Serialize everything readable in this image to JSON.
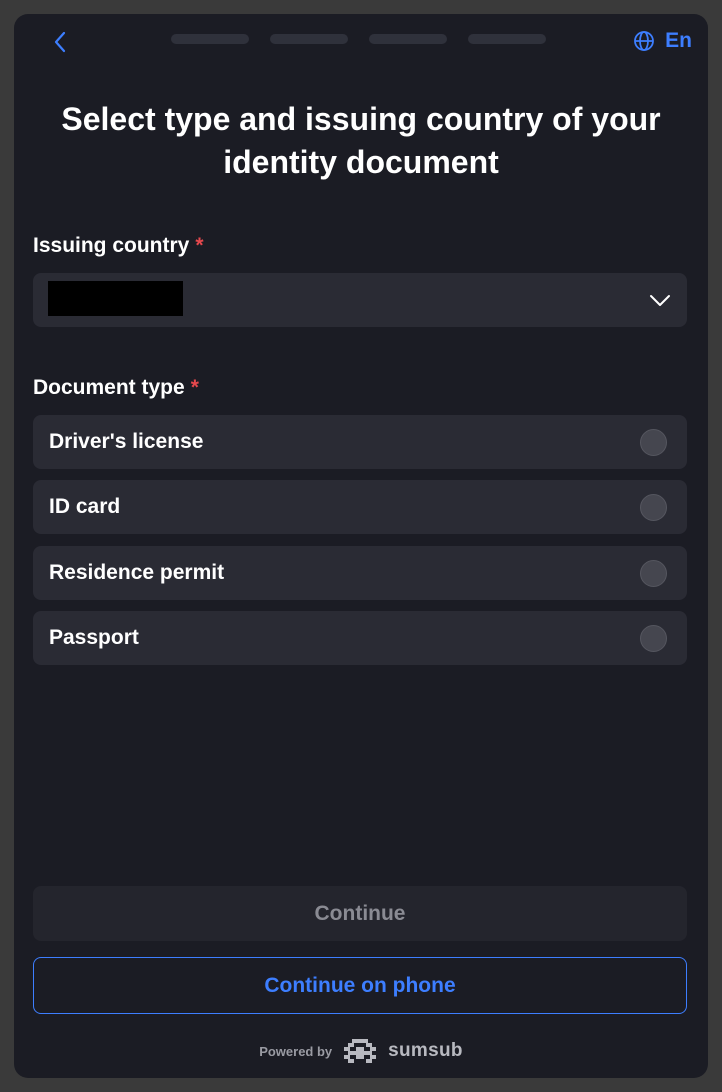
{
  "header": {
    "back_icon": "chevron-left-icon",
    "progress_steps": 4,
    "language_icon": "globe-icon",
    "language_label": "En"
  },
  "title": "Select type and issuing country of your identity document",
  "issuing_country": {
    "label": "Issuing country",
    "required_mark": "*",
    "value_redacted": true,
    "chevron_icon": "chevron-down-icon"
  },
  "document_type": {
    "label": "Document type",
    "required_mark": "*",
    "options": [
      {
        "label": "Driver's license",
        "selected": false
      },
      {
        "label": "ID card",
        "selected": false
      },
      {
        "label": "Residence permit",
        "selected": false
      },
      {
        "label": "Passport",
        "selected": false
      }
    ]
  },
  "actions": {
    "continue_label": "Continue",
    "continue_on_phone_label": "Continue on phone"
  },
  "footer": {
    "powered_by": "Powered by",
    "brand": "sumsub",
    "brand_icon": "sumsub-logo-icon"
  },
  "colors": {
    "accent": "#3d7eff",
    "required": "#e5484d",
    "background": "#1b1c24",
    "surface": "#2a2b34"
  }
}
